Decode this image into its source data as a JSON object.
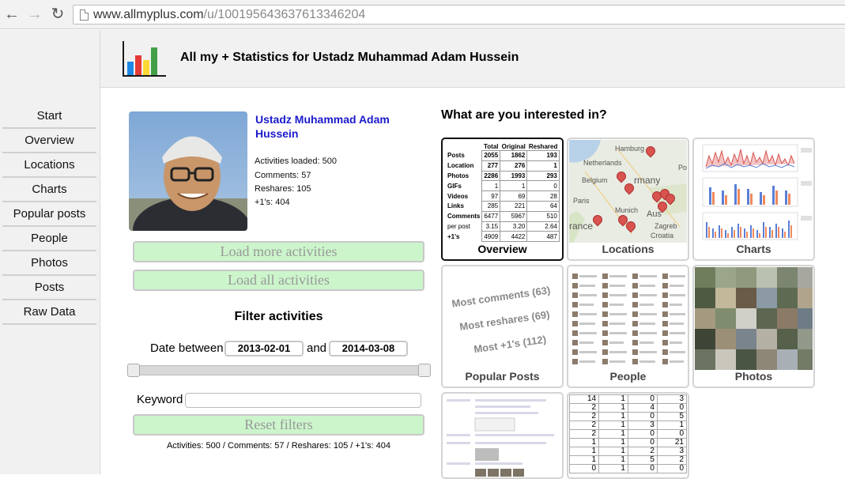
{
  "browser": {
    "url_host": "www.allmyplus.com",
    "url_path": "/u/100195643637613346204"
  },
  "header": {
    "title": "All my + Statistics for Ustadz Muhammad Adam Hussein",
    "logo_colors": [
      "#1a1a1a",
      "#e53935",
      "#fdd835",
      "#1e88e5",
      "#43a047"
    ]
  },
  "sidebar": {
    "items": [
      {
        "label": "Start"
      },
      {
        "label": "Overview"
      },
      {
        "label": "Locations"
      },
      {
        "label": "Charts"
      },
      {
        "label": "Popular posts"
      },
      {
        "label": "People"
      },
      {
        "label": "Photos"
      },
      {
        "label": "Posts"
      },
      {
        "label": "Raw Data"
      }
    ]
  },
  "profile": {
    "name": "Ustadz Muhammad Adam Hussein",
    "activities_loaded": "Activities loaded: 500",
    "comments": "Comments: 57",
    "reshares": "Reshares: 105",
    "plusones": "+1's: 404"
  },
  "buttons": {
    "load_more": "Load more activities",
    "load_all": "Load all activities",
    "reset": "Reset filters"
  },
  "filter": {
    "title": "Filter activities",
    "date_label": "Date between",
    "date_from": "2013-02-01",
    "and_label": "and",
    "date_to": "2014-03-08",
    "keyword_label": "Keyword",
    "keyword_value": ""
  },
  "summary": "Activities: 500 / Comments: 57 / Reshares: 105 / +1's: 404",
  "interests": {
    "title": "What are you interested in?",
    "tiles": [
      {
        "label": "Overview"
      },
      {
        "label": "Locations"
      },
      {
        "label": "Charts"
      },
      {
        "label": "Popular Posts"
      },
      {
        "label": "People"
      },
      {
        "label": "Photos"
      }
    ]
  },
  "overview_table": {
    "headers": [
      "Total",
      "Original",
      "Reshared"
    ],
    "rows": [
      {
        "label": "Posts",
        "values": [
          "2055",
          "1862",
          "193"
        ]
      },
      {
        "label": "Location",
        "values": [
          "277",
          "276",
          "1"
        ]
      },
      {
        "label": "Photos",
        "values": [
          "2286",
          "1993",
          "293"
        ]
      },
      {
        "label": "GIFs",
        "values": [
          "1",
          "1",
          "0"
        ]
      },
      {
        "label": "Videos",
        "values": [
          "97",
          "69",
          "28"
        ]
      },
      {
        "label": "Links",
        "values": [
          "285",
          "221",
          "64"
        ]
      },
      {
        "label": "Comments",
        "values": [
          "6477",
          "5967",
          "510"
        ]
      },
      {
        "label": "per post",
        "values": [
          "3.15",
          "3.20",
          "2.64"
        ]
      },
      {
        "label": "+1's",
        "values": [
          "4909",
          "4422",
          "487"
        ]
      }
    ]
  },
  "map_labels": {
    "hamburg": "Hamburg",
    "netherlands": "Netherlands",
    "belgium": "Belgium",
    "germany": "rmany",
    "paris": "Paris",
    "munich": "Munich",
    "france": "rance",
    "austria": "Aus",
    "zagreb": "Zagreb",
    "croatia": "Croatia",
    "pola": "Pola"
  },
  "popular_posts": {
    "most_comments": "Most comments (63)",
    "most_reshares": "Most reshares (69)",
    "most_plusones": "Most +1's (112)"
  },
  "raw_data_rows": [
    [
      "14",
      "1",
      "0",
      "3"
    ],
    [
      "2",
      "1",
      "4",
      "0"
    ],
    [
      "2",
      "1",
      "0",
      "5"
    ],
    [
      "2",
      "1",
      "3",
      "1"
    ],
    [
      "2",
      "1",
      "0",
      "0"
    ],
    [
      "1",
      "1",
      "0",
      "21"
    ],
    [
      "1",
      "1",
      "2",
      "3"
    ],
    [
      "1",
      "1",
      "5",
      "2"
    ],
    [
      "0",
      "1",
      "0",
      "0"
    ]
  ]
}
